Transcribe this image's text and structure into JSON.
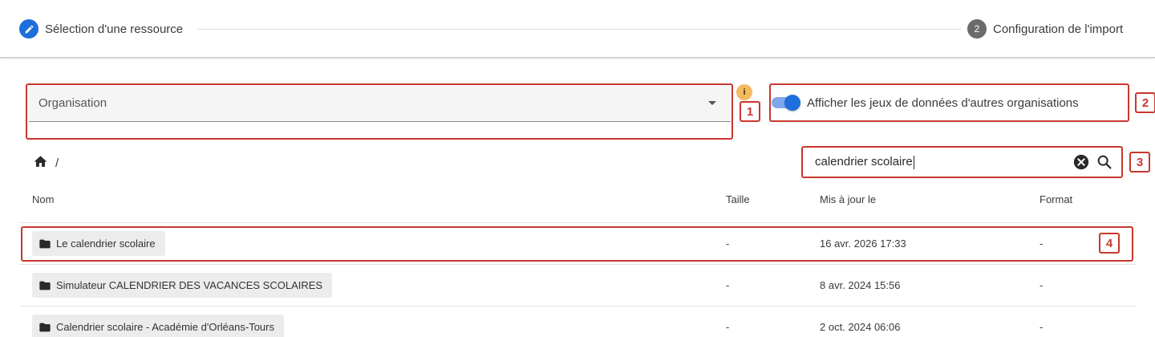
{
  "stepper": {
    "steps": [
      {
        "label": "Sélection d'une ressource",
        "number": "",
        "state": "active"
      },
      {
        "label": "Configuration de l'import",
        "number": "2",
        "state": "pending"
      }
    ]
  },
  "filters": {
    "organisation_label": "Organisation",
    "info_badge": "i",
    "toggle_label": "Afficher les jeux de données d'autres organisations",
    "toggle_on": true
  },
  "breadcrumb": {
    "separator": "/"
  },
  "search": {
    "value": "calendrier scolaire"
  },
  "table": {
    "columns": [
      "Nom",
      "Taille",
      "Mis à jour le",
      "Format"
    ],
    "rows": [
      {
        "name": "Le calendrier scolaire",
        "size": "-",
        "updated": "16 avr. 2026 17:33",
        "format": "-"
      },
      {
        "name": "Simulateur CALENDRIER DES VACANCES SCOLAIRES",
        "size": "-",
        "updated": "8 avr. 2024 15:56",
        "format": "-"
      },
      {
        "name": "Calendrier scolaire - Académie d'Orléans-Tours",
        "size": "-",
        "updated": "2 oct. 2024 06:06",
        "format": "-"
      }
    ]
  },
  "annotations": [
    "1",
    "2",
    "3",
    "4"
  ],
  "colors": {
    "accent": "#1e6fdc",
    "annotation": "#c8372d",
    "info_badge": "#f5b961"
  }
}
